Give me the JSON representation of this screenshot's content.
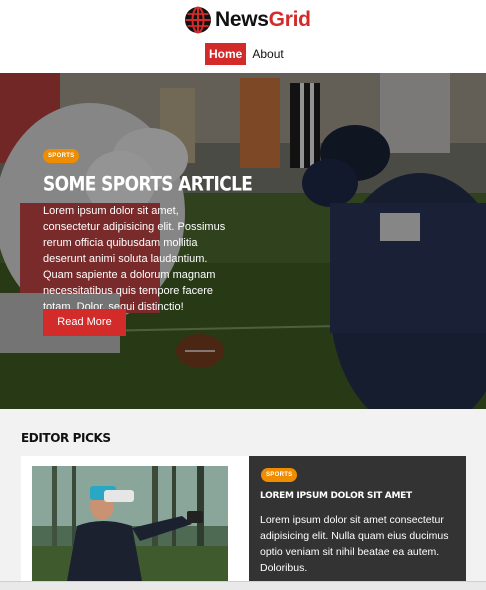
{
  "brand": {
    "name_part1": "News",
    "name_part2": "Grid",
    "logo_icon": "globe-icon"
  },
  "nav": {
    "items": [
      {
        "label": "Home",
        "active": true
      },
      {
        "label": "About",
        "active": false
      }
    ]
  },
  "hero": {
    "badge": "SPORTS",
    "title": "SOME SPORTS ARTICLE",
    "text": "Lorem ipsum dolor sit amet, consectetur adipisicing elit. Possimus rerum officia quibusdam mollitia deserunt animi soluta laudantium. Quam sapiente a dolorum magnam necessitatibus quis tempore facere totam. Dolor, sequi distinctio!",
    "button_label": "Read More",
    "image": "football-linemen-photo"
  },
  "editor_picks": {
    "heading": "EDITOR PICKS",
    "items": [
      {
        "badge": "SPORTS",
        "title": "LOREM IPSUM DOLOR SIT AMET",
        "text": "Lorem ipsum dolor sit amet consectetur adipisicing elit. Nulla quam eius ducimus optio veniam sit nihil beatae ea autem. Doloribus.",
        "image": "vr-headset-photo"
      }
    ]
  },
  "colors": {
    "accent": "#d32a2a",
    "badge": "#f08c00",
    "card_dark": "#333333"
  }
}
